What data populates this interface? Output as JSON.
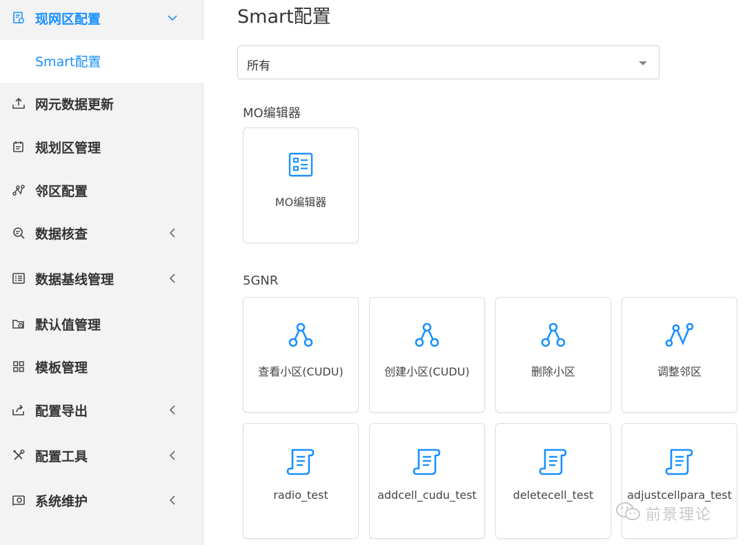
{
  "sidebar": {
    "items": [
      {
        "label": "现网区配置",
        "icon": "config-doc-icon"
      },
      {
        "label": "Smart配置"
      },
      {
        "label": "网元数据更新",
        "icon": "upload-icon"
      },
      {
        "label": "规划区管理",
        "icon": "calendar-icon"
      },
      {
        "label": "邻区配置",
        "icon": "neighbor-icon"
      },
      {
        "label": "数据核查",
        "icon": "search-check-icon"
      },
      {
        "label": "数据基线管理",
        "icon": "list-icon"
      },
      {
        "label": "默认值管理",
        "icon": "folder-clock-icon"
      },
      {
        "label": "模板管理",
        "icon": "grid-icon"
      },
      {
        "label": "配置导出",
        "icon": "export-icon"
      },
      {
        "label": "配置工具",
        "icon": "tools-icon"
      },
      {
        "label": "系统维护",
        "icon": "maintenance-icon"
      }
    ]
  },
  "main": {
    "title": "Smart配置",
    "filter": {
      "value": "所有"
    },
    "sections": [
      {
        "title": "MO编辑器",
        "cards": [
          {
            "label": "MO编辑器",
            "icon": "mo-editor-icon"
          }
        ]
      },
      {
        "title": "5GNR",
        "cards": [
          {
            "label": "查看小区(CUDU)",
            "icon": "nodes-icon"
          },
          {
            "label": "创建小区(CUDU)",
            "icon": "nodes-icon"
          },
          {
            "label": "删除小区",
            "icon": "nodes-icon"
          },
          {
            "label": "调整邻区",
            "icon": "neighbor-icon"
          },
          {
            "label": "radio_test",
            "icon": "script-icon"
          },
          {
            "label": "addcell_cudu_test",
            "icon": "script-icon"
          },
          {
            "label": "deletecell_test",
            "icon": "script-icon"
          },
          {
            "label": "adjustcellpara_test",
            "icon": "script-icon"
          }
        ]
      }
    ]
  },
  "watermark": {
    "text": "前景理论"
  },
  "colors": {
    "accent": "#1890ff",
    "sidebar_bg": "#f3f3f3",
    "text": "#333333"
  }
}
